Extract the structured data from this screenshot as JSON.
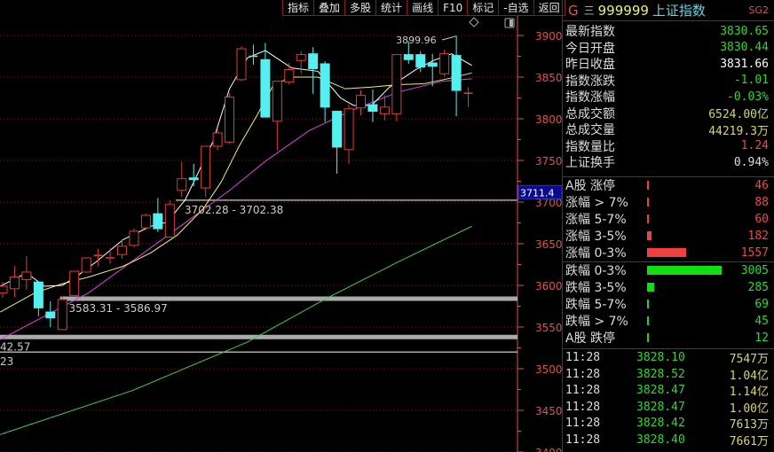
{
  "toolbar": [
    "指标",
    "叠加",
    "多股",
    "统计",
    "画线",
    "F10",
    "标记",
    "-自选",
    "返回"
  ],
  "header": {
    "market": "G",
    "menu_icon": "三",
    "code": "999999",
    "name": "上证指数",
    "tag": "SG2"
  },
  "stats": [
    {
      "label": "最新指数",
      "value": "3830.65",
      "color": "green"
    },
    {
      "label": "今日开盘",
      "value": "3830.44",
      "color": "green"
    },
    {
      "label": "昨日收盘",
      "value": "3831.66",
      "color": "white"
    },
    {
      "label": "指数涨跌",
      "value": "-1.01",
      "color": "green"
    },
    {
      "label": "指数涨幅",
      "value": "-0.03%",
      "color": "green"
    },
    {
      "label": "总成交额",
      "value": "6524.00亿",
      "color": "yellow"
    },
    {
      "label": "总成交量",
      "value": "44219.3万",
      "color": "yellow"
    },
    {
      "label": "指数量比",
      "value": "1.24",
      "color": "red"
    },
    {
      "label": "上证换手",
      "value": "0.94%",
      "color": "gray"
    }
  ],
  "breadth_up": [
    {
      "label": "A股 涨停",
      "value": "46"
    },
    {
      "label": "涨幅 > 7%",
      "value": "88"
    },
    {
      "label": "涨幅 5-7%",
      "value": "60"
    },
    {
      "label": "涨幅 3-5%",
      "value": "182"
    },
    {
      "label": "涨幅 0-3%",
      "value": "1557"
    }
  ],
  "breadth_down": [
    {
      "label": "跌幅 0-3%",
      "value": "3005"
    },
    {
      "label": "跌幅 3-5%",
      "value": "285"
    },
    {
      "label": "跌幅 5-7%",
      "value": "69"
    },
    {
      "label": "跌幅 > 7%",
      "value": "45"
    },
    {
      "label": "A股 跌停",
      "value": "12"
    }
  ],
  "ticks": [
    {
      "time": "11:28",
      "price": "3828.10",
      "vol": "7547万"
    },
    {
      "time": "11:28",
      "price": "3828.52",
      "vol": "1.04亿"
    },
    {
      "time": "11:28",
      "price": "3828.47",
      "vol": "1.14亿"
    },
    {
      "time": "11:28",
      "price": "3828.47",
      "vol": "1.00亿"
    },
    {
      "time": "11:28",
      "price": "3828.42",
      "vol": "7613万"
    },
    {
      "time": "11:28",
      "price": "3828.40",
      "vol": "7661万"
    }
  ],
  "chart_data": {
    "type": "candlestick",
    "y_ticks": [
      3900,
      3850,
      3800,
      3750,
      3700,
      3650,
      3600,
      3550,
      3500,
      3450,
      3400
    ],
    "ylim": [
      3400,
      3900
    ],
    "current_marker": "3711.4",
    "high_label": "3899.96",
    "colors": {
      "up": "#e03c3c",
      "down": "#54f0f0",
      "ma5": "#ffffff",
      "ma10": "#f0f070",
      "ma20": "#e040e0",
      "ma60": "#40d040",
      "axis": "#e05050"
    },
    "candles": [
      [
        3591,
        3604,
        3585,
        3599
      ],
      [
        3596,
        3623,
        3586,
        3610
      ],
      [
        3607,
        3635,
        3595,
        3616
      ],
      [
        3604,
        3604,
        3563,
        3573
      ],
      [
        3568,
        3581,
        3550,
        3561
      ],
      [
        3547,
        3587,
        3547,
        3583
      ],
      [
        3588,
        3617,
        3588,
        3617
      ],
      [
        3616,
        3633,
        3615,
        3633
      ],
      [
        3635,
        3644,
        3623,
        3636
      ],
      [
        3632,
        3645,
        3626,
        3633
      ],
      [
        3637,
        3655,
        3632,
        3647
      ],
      [
        3648,
        3668,
        3646,
        3665
      ],
      [
        3669,
        3686,
        3667,
        3684
      ],
      [
        3686,
        3705,
        3664,
        3668
      ],
      [
        3658,
        3702,
        3658,
        3697
      ],
      [
        3714,
        3748,
        3706,
        3728
      ],
      [
        3729,
        3746,
        3719,
        3727
      ],
      [
        3717,
        3767,
        3706,
        3767
      ],
      [
        3767,
        3788,
        3762,
        3783
      ],
      [
        3772,
        3831,
        3770,
        3826
      ],
      [
        3847,
        3887,
        3845,
        3884
      ],
      [
        3875,
        3889,
        3865,
        3874
      ],
      [
        3871,
        3891,
        3802,
        3802
      ],
      [
        3797,
        3845,
        3762,
        3845
      ],
      [
        3844,
        3867,
        3841,
        3859
      ],
      [
        3870,
        3881,
        3854,
        3877
      ],
      [
        3878,
        3886,
        3830,
        3860
      ],
      [
        3866,
        3869,
        3796,
        3814
      ],
      [
        3809,
        3809,
        3734,
        3766
      ],
      [
        3763,
        3817,
        3746,
        3812
      ],
      [
        3813,
        3834,
        3804,
        3828
      ],
      [
        3817,
        3835,
        3796,
        3809
      ],
      [
        3806,
        3828,
        3798,
        3814
      ],
      [
        3806,
        3877,
        3797,
        3877
      ],
      [
        3877,
        3893,
        3866,
        3871
      ],
      [
        3877,
        3881,
        3856,
        3862
      ],
      [
        3867,
        3878,
        3839,
        3863
      ],
      [
        3854,
        3883,
        3851,
        3878
      ],
      [
        3876,
        3899.96,
        3803,
        3834
      ],
      [
        3830.44,
        3838,
        3814,
        3830.65
      ]
    ],
    "ma5": [
      [
        -0.2,
        3599
      ],
      [
        2,
        3615
      ],
      [
        3.5,
        3599
      ],
      [
        5,
        3600
      ],
      [
        6.4,
        3613
      ],
      [
        7.9,
        3629
      ],
      [
        10.1,
        3655
      ],
      [
        12.4,
        3671
      ],
      [
        13.8,
        3676
      ],
      [
        15.3,
        3703
      ],
      [
        17.6,
        3772
      ],
      [
        19,
        3836
      ],
      [
        20.5,
        3873
      ],
      [
        22,
        3882
      ],
      [
        24.2,
        3861
      ],
      [
        26.4,
        3857
      ],
      [
        28.3,
        3825
      ],
      [
        29.4,
        3816
      ],
      [
        30.9,
        3816
      ],
      [
        32.4,
        3838
      ],
      [
        34.6,
        3859
      ],
      [
        36.1,
        3870
      ],
      [
        37.6,
        3878
      ],
      [
        39.3,
        3864
      ]
    ],
    "ma10": [
      [
        -0.2,
        3568
      ],
      [
        2.7,
        3591
      ],
      [
        5,
        3602
      ],
      [
        7.2,
        3610
      ],
      [
        10.1,
        3623
      ],
      [
        12.4,
        3639
      ],
      [
        14.6,
        3660
      ],
      [
        16.8,
        3692
      ],
      [
        18.3,
        3724
      ],
      [
        19.8,
        3767
      ],
      [
        21.3,
        3804
      ],
      [
        22.7,
        3841
      ],
      [
        24.2,
        3850
      ],
      [
        26.4,
        3850
      ],
      [
        28.7,
        3836
      ],
      [
        30.9,
        3838
      ],
      [
        33.1,
        3841
      ],
      [
        35.3,
        3842
      ],
      [
        37.6,
        3849
      ],
      [
        39.3,
        3855
      ]
    ],
    "ma20": [
      [
        -0.2,
        3535
      ],
      [
        7.2,
        3591
      ],
      [
        14.6,
        3668
      ],
      [
        19,
        3714
      ],
      [
        22,
        3749
      ],
      [
        25.7,
        3786
      ],
      [
        29.4,
        3811
      ],
      [
        33.1,
        3832
      ],
      [
        36.8,
        3845
      ],
      [
        39.3,
        3848
      ]
    ],
    "ma60": [
      [
        -0.2,
        3421
      ],
      [
        10.9,
        3474
      ],
      [
        20.5,
        3532
      ],
      [
        27.2,
        3585
      ],
      [
        33.1,
        3628
      ],
      [
        39.3,
        3671
      ]
    ],
    "levels": [
      {
        "price": 3702.3,
        "label": "3702.28 - 3702.38",
        "thick": false,
        "from": 14.5
      },
      {
        "price": 3584,
        "label": "3583.31 - 3586.97",
        "thick": true,
        "from": 4.8
      },
      {
        "price": 3538,
        "label": "42.57",
        "thick": true,
        "from": -1
      },
      {
        "price": 3520,
        "label": "23",
        "thick": false,
        "from": -1
      }
    ]
  }
}
